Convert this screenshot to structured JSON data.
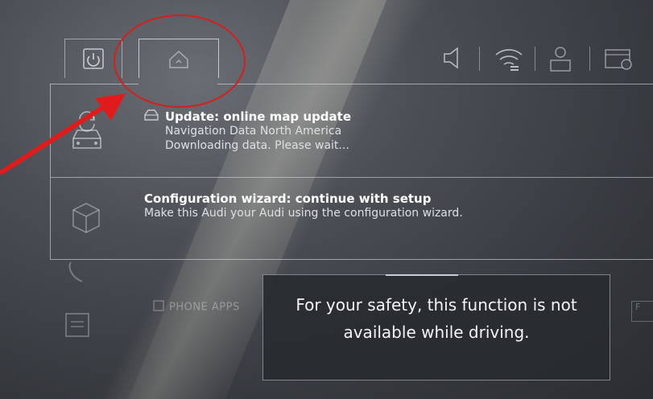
{
  "topbar": {
    "tabs": [
      {
        "name": "power",
        "icon": "power-icon"
      },
      {
        "name": "home",
        "icon": "home-icon"
      }
    ],
    "status_icons": [
      "speaker-icon",
      "wifi-icon",
      "user-profile-icon",
      "settings-screen-icon"
    ]
  },
  "notifications": [
    {
      "icon": "car-update-icon",
      "small_icon": "navigation-icon",
      "title": "Update: online map update",
      "lines": [
        "Navigation Data North America",
        "Downloading data. Please wait..."
      ]
    },
    {
      "icon": "cube-icon",
      "title": "Configuration wizard: continue with setup",
      "lines": [
        "Make this Audi your Audi using the configuration wizard."
      ]
    }
  ],
  "background": {
    "phone_apps_label": "PHONE APPS",
    "phone_apps_icon": "phone-apps-icon"
  },
  "warning": {
    "line1": "For your safety, this function is not",
    "line2": "available while driving."
  },
  "annotation": {
    "circle_color": "#d22020",
    "arrow_color": "#e01b1b"
  },
  "colors": {
    "screen_bg": "#3a3d42",
    "text_primary": "#ffffff"
  }
}
